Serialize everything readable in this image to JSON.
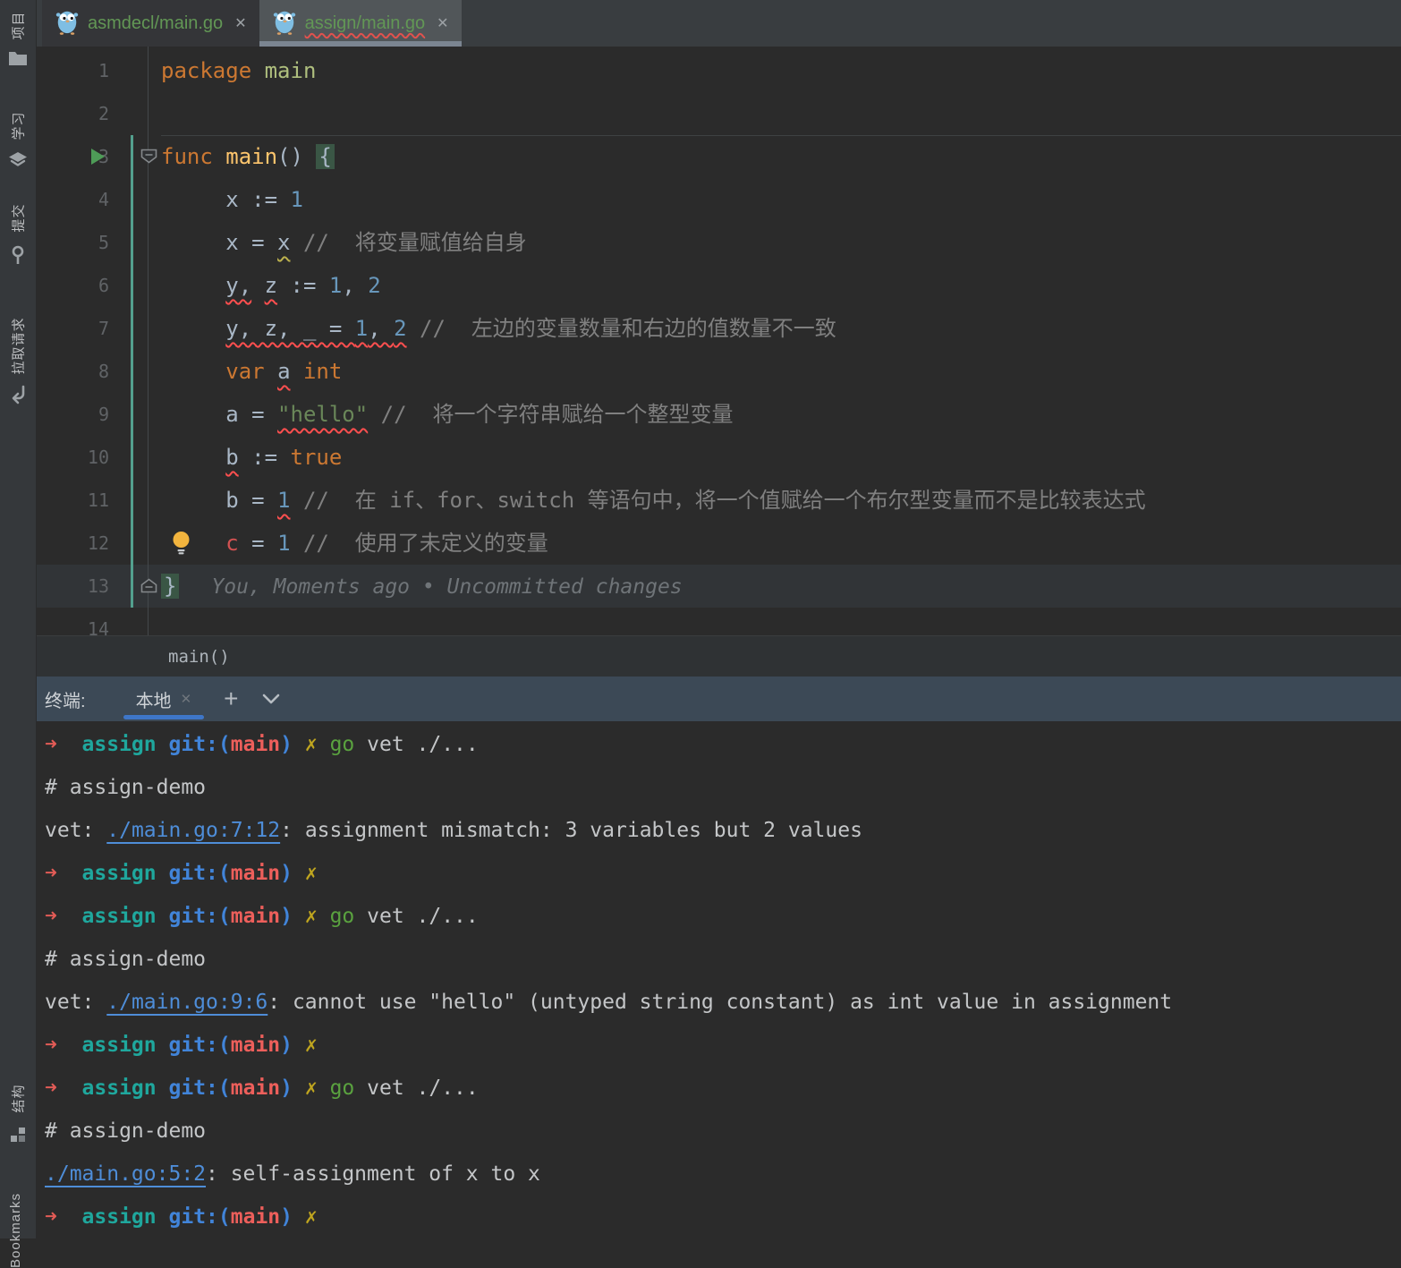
{
  "colors": {
    "accent_blue": "#3E76C8",
    "vcs_added_green": "#53A08E",
    "tab_file_green": "#629755",
    "error_red": "#E0524E",
    "warning_yellow": "#BCB14D",
    "keyword_orange": "#CC7832",
    "terminal_header_bg": "#3C4956"
  },
  "icons": {
    "close_glyph": "✕",
    "plus_glyph": "+"
  },
  "stripe": {
    "top": [
      {
        "name": "project",
        "label": "项目",
        "icon": "folder-icon"
      },
      {
        "name": "learn",
        "label": "学习",
        "icon": "learn-icon"
      },
      {
        "name": "commit",
        "label": "提交",
        "icon": "commit-icon"
      },
      {
        "name": "pull-requests",
        "label": "拉取请求",
        "icon": "pull-request-icon"
      }
    ],
    "bottom": [
      {
        "name": "structure",
        "label": "结构",
        "icon": "structure-icon"
      },
      {
        "name": "bookmarks",
        "label": "Bookmarks",
        "visible_part": "marks",
        "icon": null
      }
    ]
  },
  "tabs": [
    {
      "label": "asmdecl/main.go",
      "active": false,
      "error": false
    },
    {
      "label": "assign/main.go",
      "active": true,
      "error": true
    }
  ],
  "editor": {
    "annotation": "You, Moments ago • Uncommitted changes",
    "breadcrumb": "main()",
    "gutter": {
      "run_line": 3,
      "bulb_line": 12,
      "fold_start_line": 3,
      "fold_end_line": 13,
      "vcs_added_from": 3,
      "vcs_added_to": 13,
      "separator_above_line": 3
    },
    "lines": [
      {
        "n": 1,
        "tokens": [
          {
            "t": "package",
            "c": "kw"
          },
          {
            "t": " ",
            "c": "d"
          },
          {
            "t": "main",
            "c": "pkg"
          }
        ]
      },
      {
        "n": 2,
        "tokens": []
      },
      {
        "n": 3,
        "tokens": [
          {
            "t": "func",
            "c": "kw"
          },
          {
            "t": " ",
            "c": "d"
          },
          {
            "t": "main",
            "c": "fn"
          },
          {
            "t": "() ",
            "c": "d"
          },
          {
            "t": "{",
            "c": "brace"
          }
        ]
      },
      {
        "n": 4,
        "tokens": [
          {
            "t": "\tx := ",
            "c": "d"
          },
          {
            "t": "1",
            "c": "num"
          }
        ]
      },
      {
        "n": 5,
        "tokens": [
          {
            "t": "\tx = ",
            "c": "d"
          },
          {
            "t": "x",
            "c": "d",
            "u": "yel"
          },
          {
            "t": " ",
            "c": "d"
          },
          {
            "t": "//  将变量赋值给自身",
            "c": "com"
          }
        ]
      },
      {
        "n": 6,
        "tokens": [
          {
            "t": "\t",
            "c": "d"
          },
          {
            "t": "y,",
            "c": "d",
            "u": "red"
          },
          {
            "t": " ",
            "c": "d"
          },
          {
            "t": "z",
            "c": "d",
            "u": "red"
          },
          {
            "t": " := ",
            "c": "d"
          },
          {
            "t": "1",
            "c": "num"
          },
          {
            "t": ", ",
            "c": "d"
          },
          {
            "t": "2",
            "c": "num"
          }
        ]
      },
      {
        "n": 7,
        "tokens": [
          {
            "t": "\t",
            "c": "d"
          },
          {
            "t": "y, z, _ = ",
            "c": "d",
            "u": "red"
          },
          {
            "t": "1",
            "c": "num",
            "u": "red"
          },
          {
            "t": ", ",
            "c": "d",
            "u": "red"
          },
          {
            "t": "2",
            "c": "num",
            "u": "red"
          },
          {
            "t": " ",
            "c": "d"
          },
          {
            "t": "//  左边的变量数量和右边的值数量不一致",
            "c": "com"
          }
        ]
      },
      {
        "n": 8,
        "tokens": [
          {
            "t": "\t",
            "c": "d"
          },
          {
            "t": "var",
            "c": "kw"
          },
          {
            "t": " ",
            "c": "d"
          },
          {
            "t": "a",
            "c": "d",
            "u": "red"
          },
          {
            "t": " ",
            "c": "d"
          },
          {
            "t": "int",
            "c": "kw"
          }
        ]
      },
      {
        "n": 9,
        "tokens": [
          {
            "t": "\ta = ",
            "c": "d"
          },
          {
            "t": "\"hello\"",
            "c": "str",
            "u": "red"
          },
          {
            "t": " ",
            "c": "d"
          },
          {
            "t": "//  将一个字符串赋给一个整型变量",
            "c": "com"
          }
        ]
      },
      {
        "n": 10,
        "tokens": [
          {
            "t": "\t",
            "c": "d"
          },
          {
            "t": "b",
            "c": "d",
            "u": "red"
          },
          {
            "t": " := ",
            "c": "d"
          },
          {
            "t": "true",
            "c": "kw"
          }
        ]
      },
      {
        "n": 11,
        "tokens": [
          {
            "t": "\t",
            "c": "d"
          },
          {
            "t": "b = ",
            "c": "d"
          },
          {
            "t": "1",
            "c": "num",
            "u": "red"
          },
          {
            "t": " ",
            "c": "d"
          },
          {
            "t": "//  在 if、for、switch 等语句中，将一个值赋给一个布尔型变量而不是比较表达式",
            "c": "com"
          }
        ]
      },
      {
        "n": 12,
        "tokens": [
          {
            "t": "\t",
            "c": "d"
          },
          {
            "t": "c",
            "c": "err"
          },
          {
            "t": " = ",
            "c": "d"
          },
          {
            "t": "1",
            "c": "num"
          },
          {
            "t": " ",
            "c": "d"
          },
          {
            "t": "//  使用了未定义的变量",
            "c": "com"
          }
        ]
      },
      {
        "n": 13,
        "caret": true,
        "ann": true,
        "tokens": [
          {
            "t": "}",
            "c": "brace"
          }
        ]
      },
      {
        "n": 14,
        "tokens": []
      }
    ]
  },
  "terminal": {
    "title": "终端:",
    "tab": {
      "label": "本地"
    },
    "lines": [
      [
        {
          "t": "➜  ",
          "c": "arrow"
        },
        {
          "t": "assign",
          "c": "dir"
        },
        {
          "t": " ",
          "c": "txt"
        },
        {
          "t": "git:(",
          "c": "git"
        },
        {
          "t": "main",
          "c": "branch"
        },
        {
          "t": ")",
          "c": "git"
        },
        {
          "t": " ",
          "c": "txt"
        },
        {
          "t": "✗",
          "c": "cross"
        },
        {
          "t": " ",
          "c": "txt"
        },
        {
          "t": "go",
          "c": "go"
        },
        {
          "t": " vet ./...",
          "c": "txt"
        }
      ],
      [
        {
          "t": "# assign-demo",
          "c": "out"
        }
      ],
      [
        {
          "t": "vet: ",
          "c": "out"
        },
        {
          "t": "./main.go:7:12",
          "c": "link"
        },
        {
          "t": ": assignment mismatch: 3 variables but 2 values",
          "c": "out"
        }
      ],
      [
        {
          "t": "➜  ",
          "c": "arrow"
        },
        {
          "t": "assign",
          "c": "dir"
        },
        {
          "t": " ",
          "c": "txt"
        },
        {
          "t": "git:(",
          "c": "git"
        },
        {
          "t": "main",
          "c": "branch"
        },
        {
          "t": ")",
          "c": "git"
        },
        {
          "t": " ",
          "c": "txt"
        },
        {
          "t": "✗",
          "c": "cross"
        }
      ],
      [
        {
          "t": "➜  ",
          "c": "arrow"
        },
        {
          "t": "assign",
          "c": "dir"
        },
        {
          "t": " ",
          "c": "txt"
        },
        {
          "t": "git:(",
          "c": "git"
        },
        {
          "t": "main",
          "c": "branch"
        },
        {
          "t": ")",
          "c": "git"
        },
        {
          "t": " ",
          "c": "txt"
        },
        {
          "t": "✗",
          "c": "cross"
        },
        {
          "t": " ",
          "c": "txt"
        },
        {
          "t": "go",
          "c": "go"
        },
        {
          "t": " vet ./...",
          "c": "txt"
        }
      ],
      [
        {
          "t": "# assign-demo",
          "c": "out"
        }
      ],
      [
        {
          "t": "vet: ",
          "c": "out"
        },
        {
          "t": "./main.go:9:6",
          "c": "link"
        },
        {
          "t": ": cannot use \"hello\" (untyped string constant) as int value in assignment",
          "c": "out"
        }
      ],
      [
        {
          "t": "➜  ",
          "c": "arrow"
        },
        {
          "t": "assign",
          "c": "dir"
        },
        {
          "t": " ",
          "c": "txt"
        },
        {
          "t": "git:(",
          "c": "git"
        },
        {
          "t": "main",
          "c": "branch"
        },
        {
          "t": ")",
          "c": "git"
        },
        {
          "t": " ",
          "c": "txt"
        },
        {
          "t": "✗",
          "c": "cross"
        }
      ],
      [
        {
          "t": "➜  ",
          "c": "arrow"
        },
        {
          "t": "assign",
          "c": "dir"
        },
        {
          "t": " ",
          "c": "txt"
        },
        {
          "t": "git:(",
          "c": "git"
        },
        {
          "t": "main",
          "c": "branch"
        },
        {
          "t": ")",
          "c": "git"
        },
        {
          "t": " ",
          "c": "txt"
        },
        {
          "t": "✗",
          "c": "cross"
        },
        {
          "t": " ",
          "c": "txt"
        },
        {
          "t": "go",
          "c": "go"
        },
        {
          "t": " vet ./...",
          "c": "txt"
        }
      ],
      [
        {
          "t": "# assign-demo",
          "c": "out"
        }
      ],
      [
        {
          "t": "./main.go:5:2",
          "c": "link"
        },
        {
          "t": ": self-assignment of x to x",
          "c": "out"
        }
      ],
      [
        {
          "t": "➜  ",
          "c": "arrow"
        },
        {
          "t": "assign",
          "c": "dir"
        },
        {
          "t": " ",
          "c": "txt"
        },
        {
          "t": "git:(",
          "c": "git"
        },
        {
          "t": "main",
          "c": "branch"
        },
        {
          "t": ")",
          "c": "git"
        },
        {
          "t": " ",
          "c": "txt"
        },
        {
          "t": "✗",
          "c": "cross"
        }
      ]
    ]
  }
}
